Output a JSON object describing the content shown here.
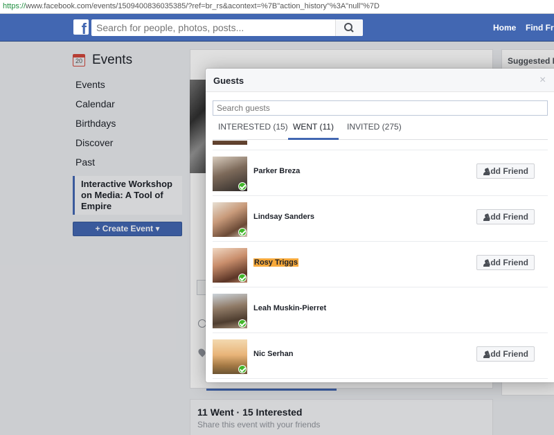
{
  "browser": {
    "url_scheme": "https://",
    "url_rest": "www.facebook.com/events/1509400836035385/?ref=br_rs&acontext=%7B\"action_history\"%3A\"null\"%7D"
  },
  "header": {
    "logo": "f",
    "search_placeholder": "Search for people, photos, posts...",
    "search_icon": "magnifier-icon",
    "nav": [
      "Home",
      "Find Frie"
    ]
  },
  "sidebar": {
    "title": "Events",
    "calendar_icon_day": "20",
    "items": [
      "Events",
      "Calendar",
      "Birthdays",
      "Discover",
      "Past"
    ],
    "active_item": "Interactive Workshop on Media: A Tool of Empire",
    "create_button": "Create Event"
  },
  "right_column": {
    "title": "Suggested Ev"
  },
  "bottom_card": {
    "summary": "11 Went · 15 Interested",
    "share_text": "Share this event with your friends"
  },
  "modal": {
    "title": "Guests",
    "close": "×",
    "search_placeholder": "Search guests",
    "tabs": [
      {
        "label": "INTERESTED (15)",
        "active": false
      },
      {
        "label": "WENT (11)",
        "active": true
      },
      {
        "label": "INVITED (275)",
        "active": false
      }
    ],
    "guests": [
      {
        "name": "Parker Breza",
        "button": "Add Friend",
        "highlighted": false
      },
      {
        "name": "Lindsay Sanders",
        "button": "Add Friend",
        "highlighted": false
      },
      {
        "name": "Rosy Triggs",
        "button": "Add Friend",
        "highlighted": true
      },
      {
        "name": "Leah Muskin-Pierret",
        "button": "",
        "highlighted": false
      },
      {
        "name": "Nic Serhan",
        "button": "Add Friend",
        "highlighted": false
      }
    ]
  },
  "colors": {
    "brand_blue": "#4267b2",
    "highlight": "#f6a93b",
    "check_green": "#42b72a"
  }
}
